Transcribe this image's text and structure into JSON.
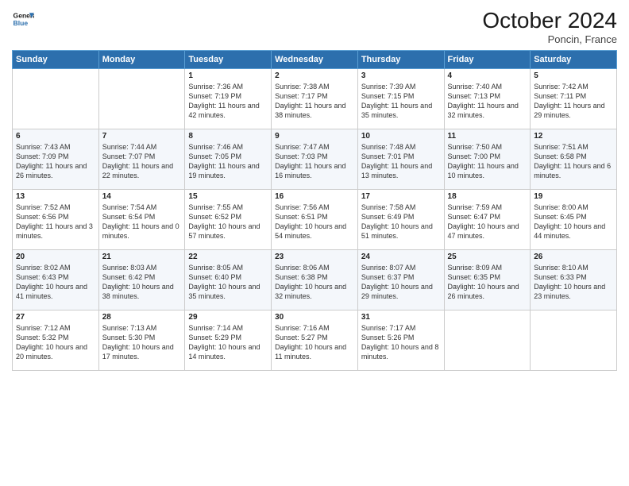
{
  "header": {
    "logo_line1": "General",
    "logo_line2": "Blue",
    "month_title": "October 2024",
    "location": "Poncin, France"
  },
  "days_of_week": [
    "Sunday",
    "Monday",
    "Tuesday",
    "Wednesday",
    "Thursday",
    "Friday",
    "Saturday"
  ],
  "weeks": [
    [
      {
        "day": "",
        "info": ""
      },
      {
        "day": "",
        "info": ""
      },
      {
        "day": "1",
        "info": "Sunrise: 7:36 AM\nSunset: 7:19 PM\nDaylight: 11 hours and 42 minutes."
      },
      {
        "day": "2",
        "info": "Sunrise: 7:38 AM\nSunset: 7:17 PM\nDaylight: 11 hours and 38 minutes."
      },
      {
        "day": "3",
        "info": "Sunrise: 7:39 AM\nSunset: 7:15 PM\nDaylight: 11 hours and 35 minutes."
      },
      {
        "day": "4",
        "info": "Sunrise: 7:40 AM\nSunset: 7:13 PM\nDaylight: 11 hours and 32 minutes."
      },
      {
        "day": "5",
        "info": "Sunrise: 7:42 AM\nSunset: 7:11 PM\nDaylight: 11 hours and 29 minutes."
      }
    ],
    [
      {
        "day": "6",
        "info": "Sunrise: 7:43 AM\nSunset: 7:09 PM\nDaylight: 11 hours and 26 minutes."
      },
      {
        "day": "7",
        "info": "Sunrise: 7:44 AM\nSunset: 7:07 PM\nDaylight: 11 hours and 22 minutes."
      },
      {
        "day": "8",
        "info": "Sunrise: 7:46 AM\nSunset: 7:05 PM\nDaylight: 11 hours and 19 minutes."
      },
      {
        "day": "9",
        "info": "Sunrise: 7:47 AM\nSunset: 7:03 PM\nDaylight: 11 hours and 16 minutes."
      },
      {
        "day": "10",
        "info": "Sunrise: 7:48 AM\nSunset: 7:01 PM\nDaylight: 11 hours and 13 minutes."
      },
      {
        "day": "11",
        "info": "Sunrise: 7:50 AM\nSunset: 7:00 PM\nDaylight: 11 hours and 10 minutes."
      },
      {
        "day": "12",
        "info": "Sunrise: 7:51 AM\nSunset: 6:58 PM\nDaylight: 11 hours and 6 minutes."
      }
    ],
    [
      {
        "day": "13",
        "info": "Sunrise: 7:52 AM\nSunset: 6:56 PM\nDaylight: 11 hours and 3 minutes."
      },
      {
        "day": "14",
        "info": "Sunrise: 7:54 AM\nSunset: 6:54 PM\nDaylight: 11 hours and 0 minutes."
      },
      {
        "day": "15",
        "info": "Sunrise: 7:55 AM\nSunset: 6:52 PM\nDaylight: 10 hours and 57 minutes."
      },
      {
        "day": "16",
        "info": "Sunrise: 7:56 AM\nSunset: 6:51 PM\nDaylight: 10 hours and 54 minutes."
      },
      {
        "day": "17",
        "info": "Sunrise: 7:58 AM\nSunset: 6:49 PM\nDaylight: 10 hours and 51 minutes."
      },
      {
        "day": "18",
        "info": "Sunrise: 7:59 AM\nSunset: 6:47 PM\nDaylight: 10 hours and 47 minutes."
      },
      {
        "day": "19",
        "info": "Sunrise: 8:00 AM\nSunset: 6:45 PM\nDaylight: 10 hours and 44 minutes."
      }
    ],
    [
      {
        "day": "20",
        "info": "Sunrise: 8:02 AM\nSunset: 6:43 PM\nDaylight: 10 hours and 41 minutes."
      },
      {
        "day": "21",
        "info": "Sunrise: 8:03 AM\nSunset: 6:42 PM\nDaylight: 10 hours and 38 minutes."
      },
      {
        "day": "22",
        "info": "Sunrise: 8:05 AM\nSunset: 6:40 PM\nDaylight: 10 hours and 35 minutes."
      },
      {
        "day": "23",
        "info": "Sunrise: 8:06 AM\nSunset: 6:38 PM\nDaylight: 10 hours and 32 minutes."
      },
      {
        "day": "24",
        "info": "Sunrise: 8:07 AM\nSunset: 6:37 PM\nDaylight: 10 hours and 29 minutes."
      },
      {
        "day": "25",
        "info": "Sunrise: 8:09 AM\nSunset: 6:35 PM\nDaylight: 10 hours and 26 minutes."
      },
      {
        "day": "26",
        "info": "Sunrise: 8:10 AM\nSunset: 6:33 PM\nDaylight: 10 hours and 23 minutes."
      }
    ],
    [
      {
        "day": "27",
        "info": "Sunrise: 7:12 AM\nSunset: 5:32 PM\nDaylight: 10 hours and 20 minutes."
      },
      {
        "day": "28",
        "info": "Sunrise: 7:13 AM\nSunset: 5:30 PM\nDaylight: 10 hours and 17 minutes."
      },
      {
        "day": "29",
        "info": "Sunrise: 7:14 AM\nSunset: 5:29 PM\nDaylight: 10 hours and 14 minutes."
      },
      {
        "day": "30",
        "info": "Sunrise: 7:16 AM\nSunset: 5:27 PM\nDaylight: 10 hours and 11 minutes."
      },
      {
        "day": "31",
        "info": "Sunrise: 7:17 AM\nSunset: 5:26 PM\nDaylight: 10 hours and 8 minutes."
      },
      {
        "day": "",
        "info": ""
      },
      {
        "day": "",
        "info": ""
      }
    ]
  ]
}
